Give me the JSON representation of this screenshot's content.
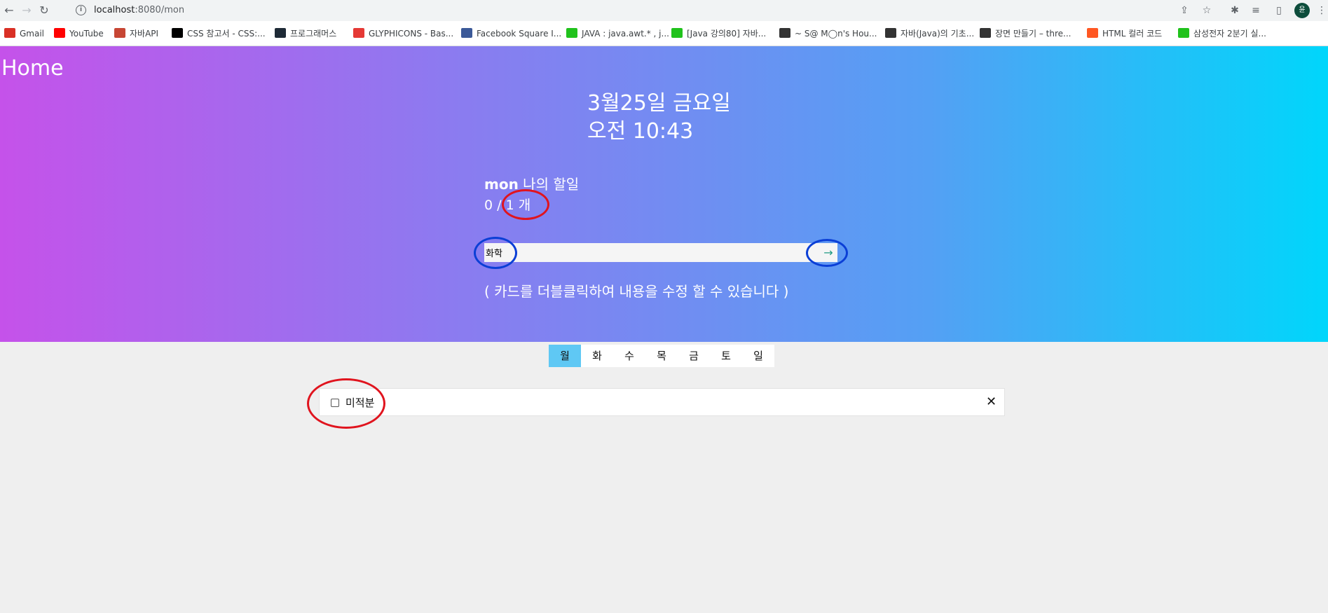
{
  "browser": {
    "url_host": "localhost",
    "url_path": ":8080/mon",
    "profile_initial": "윤"
  },
  "bookmarks": [
    {
      "label": "Gmail",
      "color": "#d93025"
    },
    {
      "label": "YouTube",
      "color": "#ff0000"
    },
    {
      "label": "자바API",
      "color": "#c74634"
    },
    {
      "label": "CSS 참고서 - CSS:...",
      "color": "#000000"
    },
    {
      "label": "프로그래머스",
      "color": "#1e2a36"
    },
    {
      "label": "GLYPHICONS - Bas...",
      "color": "#e53935"
    },
    {
      "label": "Facebook Square I...",
      "color": "#3b5998"
    },
    {
      "label": "JAVA : java.awt.* , j...",
      "color": "#20c21c"
    },
    {
      "label": "[Java 강의80] 자바...",
      "color": "#20c21c"
    },
    {
      "label": "~ S@ M◯n's Hou...",
      "color": "#333333"
    },
    {
      "label": "자바(Java)의 기초...",
      "color": "#333333"
    },
    {
      "label": "장면 만들기 – thre...",
      "color": "#333333"
    },
    {
      "label": "HTML 컬러 코드",
      "color": "#ff5722"
    },
    {
      "label": "삼성전자 2분기 실...",
      "color": "#20c21c"
    }
  ],
  "page": {
    "home_label": "Home",
    "date_text": "3월25일 금요일",
    "time_text": "오전 10:43",
    "todo_title_user": "mon",
    "todo_title_suffix": " 나의 할일",
    "count_text": "0 / 1 개",
    "input_value": "화학",
    "submit_icon": "→",
    "hint_text": "( 카드를 더블클릭하여 내용을 수정 할 수 있습니다 )",
    "days": [
      "월",
      "화",
      "수",
      "목",
      "금",
      "토",
      "일"
    ],
    "active_day": "월",
    "todo_item": "미적분",
    "close_icon": "✕"
  },
  "colors": {
    "gradient_start": "#c552ea",
    "gradient_end": "#00d6fb",
    "active_day_bg": "#5fc8f4",
    "annotation_red": "#e0141e",
    "annotation_blue": "#0b3fd6"
  }
}
